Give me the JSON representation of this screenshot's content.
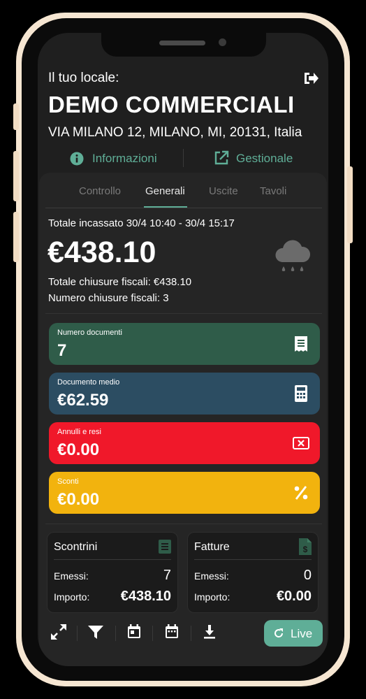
{
  "header": {
    "prefix": "Il tuo locale:",
    "name": "DEMO COMMERCIALI",
    "address": "VIA MILANO 12, MILANO, MI, 20131, Italia",
    "info_label": "Informazioni",
    "manage_label": "Gestionale"
  },
  "tabs": [
    {
      "label": "Controllo"
    },
    {
      "label": "Generali"
    },
    {
      "label": "Uscite"
    },
    {
      "label": "Tavoli"
    }
  ],
  "summary": {
    "period": "Totale incassato 30/4 10:40 - 30/4 15:17",
    "total": "€438.10",
    "fiscal_total": "Totale chiusure fiscali: €438.10",
    "fiscal_count": "Numero chiusure fiscali: 3",
    "weather_icon": "rain-cloud-icon"
  },
  "cards": [
    {
      "label": "Numero documenti",
      "value": "7",
      "color": "#2f5c49",
      "icon": "receipt-icon"
    },
    {
      "label": "Documento medio",
      "value": "€62.59",
      "color": "#2c4d62",
      "icon": "calculator-icon"
    },
    {
      "label": "Annulli e resi",
      "value": "€0.00",
      "color": "#f0182a",
      "icon": "cancel-box-icon"
    },
    {
      "label": "Sconti",
      "value": "€0.00",
      "color": "#f2b30e",
      "icon": "percent-icon"
    }
  ],
  "receipts": {
    "title": "Scontrini",
    "issued_label": "Emessi:",
    "issued": "7",
    "amount_label": "Importo:",
    "amount": "€438.10"
  },
  "invoices": {
    "title": "Fatture",
    "issued_label": "Emessi:",
    "issued": "0",
    "amount_label": "Importo:",
    "amount": "€0.00"
  },
  "toolbar": {
    "live_label": "Live"
  },
  "colors": {
    "accent": "#5fae97",
    "background": "#1f1f1f",
    "panel": "#252525"
  }
}
